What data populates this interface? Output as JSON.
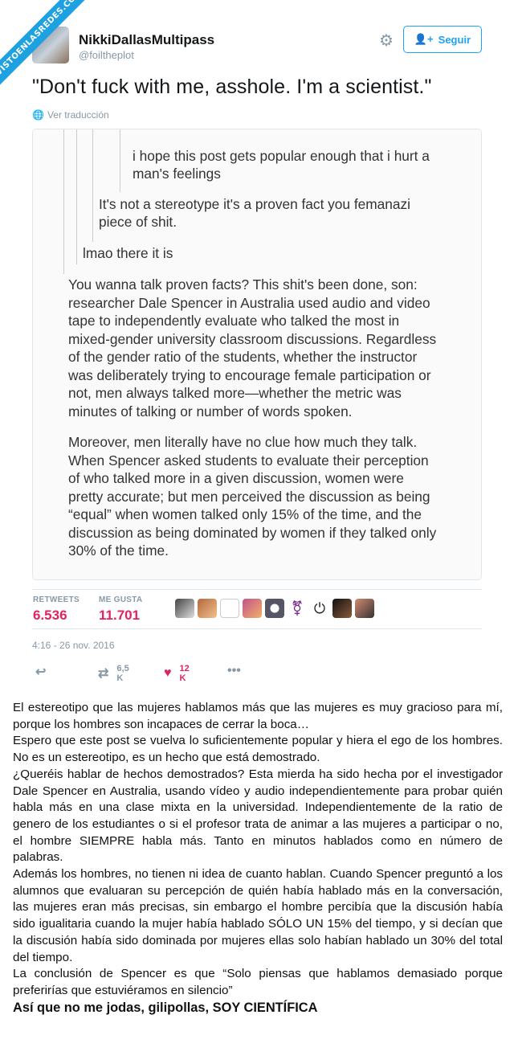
{
  "ribbon": "VISTOENLASREDES.COM",
  "tweet": {
    "display_name": "NikkiDallasMultipass",
    "handle": "@foiltheplot",
    "follow_label": "Seguir",
    "text": "\"Don't fuck with me, asshole. I'm a scientist.\"",
    "translate_label": "Ver traducción",
    "retweets_label": "RETWEETS",
    "retweets_value": "6.536",
    "likes_label": "ME GUSTA",
    "likes_value": "11.701",
    "timestamp": "4:16 - 26 nov. 2016",
    "retweet_count": "6,5 K",
    "like_count": "12 K",
    "more_label": "•••"
  },
  "image_text": {
    "q1_top": "i hope this post gets popular enough that i hurt a",
    "q1_bottom": "man's feelings",
    "q2_line1": "It's not a stereotype it's a proven fact you femanazi",
    "q2_line2": "piece of shit.",
    "q3": "lmao there it is",
    "p1": [
      "You wanna talk proven facts? This shit's been done, son:",
      "researcher Dale Spencer in Australia used audio and video",
      "tape to independently evaluate who talked the most in",
      "mixed-gender university classroom discussions. Regardless",
      "of the gender ratio of the students, whether the instructor",
      "was deliberately trying to encourage female participation or",
      "not, men always talked more—whether the metric was",
      "minutes of talking or number of words spoken."
    ],
    "p2": [
      "Moreover, men literally have no clue how much they talk.",
      "When Spencer asked students to evaluate their perception",
      "of who talked more in a given discussion, women were",
      "pretty accurate; but men perceived the discussion as being",
      "“equal” when women talked only 15% of the time, and the",
      "discussion as being dominated by women if they talked only",
      "30% of the time."
    ]
  },
  "transcript": [
    "El estereotipo que las mujeres hablamos más que las mujeres es muy gracioso para mí, porque los hombres son incapaces de cerrar la boca…",
    "Espero que este post se vuelva lo suficientemente popular y hiera el ego de los hombres. No es un estereotipo, es un hecho que está demostrado.",
    "¿Queréis hablar de hechos demostrados? Esta mierda ha sido hecha por el investigador Dale Spencer en Australia, usando vídeo y audio independientemente para probar quién habla más en una clase mixta en la universidad. Independientemente de la ratio de genero de los estudiantes o si el profesor trata de animar a las mujeres a participar o no, el hombre SIEMPRE habla más. Tanto en minutos hablados como en número de palabras.",
    "Además los hombres, no tienen ni idea de cuanto hablan. Cuando Spencer preguntó a los alumnos que evaluaran su percepción de quién había hablado más en la conversación, las mujeres eran más precisas, sin embargo el hombre percibía que la discusión había sido igualitaria cuando la mujer había hablado SÓLO UN 15% del tiempo, y si decían que la discusión había sido dominada por mujeres ellas solo habían hablado un 30% del total del tiempo.",
    "La conclusión de Spencer es que “Solo piensas que hablamos demasiado porque preferirías que estuviéramos en silencio”",
    "Así que no me jodas, gilipollas, SOY CIENTÍFICA"
  ],
  "colors": {
    "accent": "#1da1f2",
    "like": "#e0245e",
    "muted": "#8899a6"
  }
}
